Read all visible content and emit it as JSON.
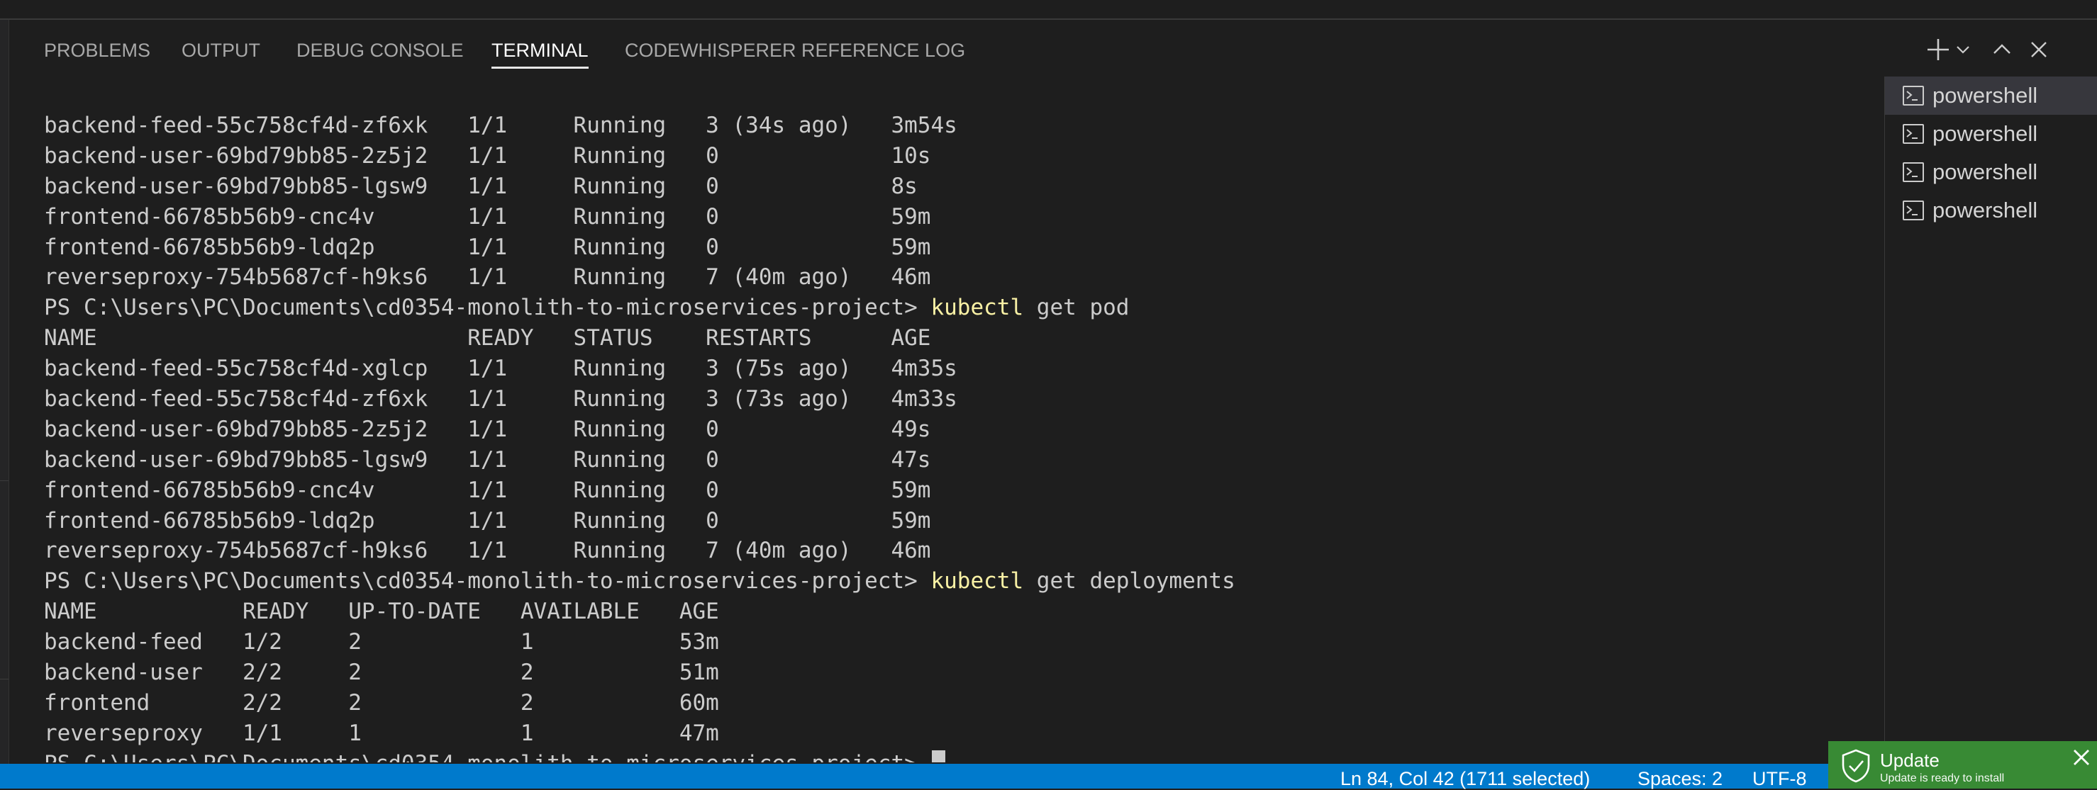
{
  "tabs": [
    {
      "label": "PROBLEMS"
    },
    {
      "label": "OUTPUT"
    },
    {
      "label": "DEBUG CONSOLE"
    },
    {
      "label": "TERMINAL"
    },
    {
      "label": "CODEWHISPERER REFERENCE LOG"
    }
  ],
  "active_tab": "TERMINAL",
  "actions": {
    "new_terminal_icon": "plus-icon",
    "dropdown_icon": "chevron-down-icon",
    "maximize_icon": "chevron-up-icon",
    "close_icon": "close-icon"
  },
  "terminal": {
    "lines": [
      {
        "prompt": "",
        "command": "",
        "text": "backend-feed-55c758cf4d-zf6xk   1/1     Running   3 (34s ago)   3m54s"
      },
      {
        "prompt": "",
        "command": "",
        "text": "backend-user-69bd79bb85-2z5j2   1/1     Running   0             10s"
      },
      {
        "prompt": "",
        "command": "",
        "text": "backend-user-69bd79bb85-lgsw9   1/1     Running   0             8s"
      },
      {
        "prompt": "",
        "command": "",
        "text": "frontend-66785b56b9-cnc4v       1/1     Running   0             59m"
      },
      {
        "prompt": "",
        "command": "",
        "text": "frontend-66785b56b9-ldq2p       1/1     Running   0             59m"
      },
      {
        "prompt": "",
        "command": "",
        "text": "reverseproxy-754b5687cf-h9ks6   1/1     Running   7 (40m ago)   46m"
      },
      {
        "prompt": "PS C:\\Users\\PC\\Documents\\cd0354-monolith-to-microservices-project> ",
        "command": "kubectl",
        "text": " get pod"
      },
      {
        "prompt": "",
        "command": "",
        "text": "NAME                            READY   STATUS    RESTARTS      AGE"
      },
      {
        "prompt": "",
        "command": "",
        "text": "backend-feed-55c758cf4d-xglcp   1/1     Running   3 (75s ago)   4m35s"
      },
      {
        "prompt": "",
        "command": "",
        "text": "backend-feed-55c758cf4d-zf6xk   1/1     Running   3 (73s ago)   4m33s"
      },
      {
        "prompt": "",
        "command": "",
        "text": "backend-user-69bd79bb85-2z5j2   1/1     Running   0             49s"
      },
      {
        "prompt": "",
        "command": "",
        "text": "backend-user-69bd79bb85-lgsw9   1/1     Running   0             47s"
      },
      {
        "prompt": "",
        "command": "",
        "text": "frontend-66785b56b9-cnc4v       1/1     Running   0             59m"
      },
      {
        "prompt": "",
        "command": "",
        "text": "frontend-66785b56b9-ldq2p       1/1     Running   0             59m"
      },
      {
        "prompt": "",
        "command": "",
        "text": "reverseproxy-754b5687cf-h9ks6   1/1     Running   7 (40m ago)   46m"
      },
      {
        "prompt": "PS C:\\Users\\PC\\Documents\\cd0354-monolith-to-microservices-project> ",
        "command": "kubectl",
        "text": " get deployments"
      },
      {
        "prompt": "",
        "command": "",
        "text": "NAME           READY   UP-TO-DATE   AVAILABLE   AGE"
      },
      {
        "prompt": "",
        "command": "",
        "text": "backend-feed   1/2     2            1           53m"
      },
      {
        "prompt": "",
        "command": "",
        "text": "backend-user   2/2     2            2           51m"
      },
      {
        "prompt": "",
        "command": "",
        "text": "frontend       2/2     2            2           60m"
      },
      {
        "prompt": "",
        "command": "",
        "text": "reverseproxy   1/1     1            1           47m"
      }
    ],
    "current_prompt": "PS C:\\Users\\PC\\Documents\\cd0354-monolith-to-microservices-project> "
  },
  "sessions": [
    {
      "label": "powershell",
      "selected": true
    },
    {
      "label": "powershell",
      "selected": false
    },
    {
      "label": "powershell",
      "selected": false
    },
    {
      "label": "powershell",
      "selected": false
    }
  ],
  "statusbar": {
    "position": "Ln 84, Col 42 (1711 selected)",
    "spaces": "Spaces: 2",
    "encoding": "UTF-8"
  },
  "notification": {
    "title": "Update",
    "subtitle": "Update is ready to install"
  },
  "colors": {
    "statusbar": "#007acc",
    "notification": "#388a34",
    "command": "#f9f1a5",
    "background": "#1e1e1e"
  }
}
